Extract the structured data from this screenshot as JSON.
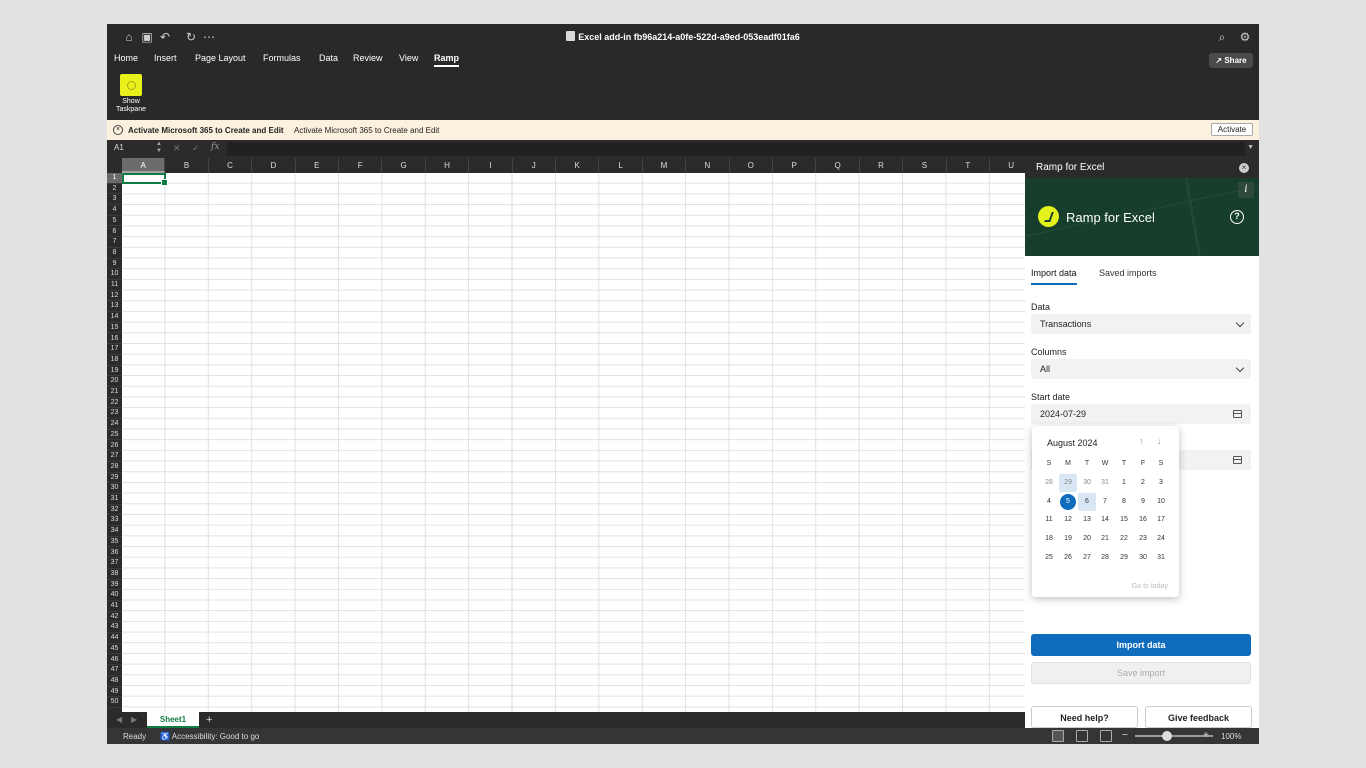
{
  "titlebar": {
    "title": "Excel add-in fb96a214-a0fe-522d-a9ed-053eadf01fa6"
  },
  "ribbon_tabs": [
    "Home",
    "Insert",
    "Page Layout",
    "Formulas",
    "Data",
    "Review",
    "View",
    "Ramp"
  ],
  "active_tab": "Ramp",
  "share_label": "Share",
  "ribbon": {
    "taskpane_line1": "Show",
    "taskpane_line2": "Taskpane"
  },
  "message_bar": {
    "bold": "Activate Microsoft 365 to Create and Edit",
    "text": "Activate Microsoft 365 to Create and Edit",
    "button": "Activate"
  },
  "formula_bar": {
    "name_box": "A1",
    "fx": "fx"
  },
  "grid": {
    "columns": [
      "A",
      "B",
      "C",
      "D",
      "E",
      "F",
      "G",
      "H",
      "I",
      "J",
      "K",
      "L",
      "M",
      "N",
      "O",
      "P",
      "Q",
      "R",
      "S",
      "T",
      "U"
    ],
    "rows": [
      "1",
      "2",
      "3",
      "4",
      "5",
      "6",
      "7",
      "8",
      "9",
      "10",
      "11",
      "12",
      "13",
      "14",
      "15",
      "16",
      "17",
      "18",
      "19",
      "20",
      "21",
      "22",
      "23",
      "24",
      "25",
      "26",
      "27",
      "28",
      "29",
      "30",
      "31",
      "32",
      "33",
      "34",
      "35",
      "36",
      "37",
      "38",
      "39",
      "40",
      "41",
      "42",
      "43",
      "44",
      "45",
      "46",
      "47",
      "48",
      "49",
      "50"
    ],
    "selected_cell": "A1"
  },
  "sheets": {
    "active": "Sheet1",
    "add": "+"
  },
  "status": {
    "ready": "Ready",
    "accessibility": "Accessibility: Good to go",
    "zoom": "100%",
    "zoom_fraction": 0.5
  },
  "taskpane": {
    "header": "Ramp for Excel",
    "hero_title": "Ramp for Excel",
    "tabs": [
      "Import data",
      "Saved imports"
    ],
    "data_label": "Data",
    "data_value": "Transactions",
    "columns_label": "Columns",
    "columns_value": "All",
    "start_label": "Start date",
    "start_value": "2024-07-29",
    "import_button": "Import data",
    "save_button": "Save import",
    "help_button": "Need help?",
    "feedback_button": "Give feedback"
  },
  "calendar": {
    "month": "August 2024",
    "weekdays": [
      "S",
      "M",
      "T",
      "W",
      "T",
      "F",
      "S"
    ],
    "weeks": [
      [
        "28",
        "29",
        "30",
        "31",
        "1",
        "2",
        "3"
      ],
      [
        "4",
        "5",
        "6",
        "7",
        "8",
        "9",
        "10"
      ],
      [
        "11",
        "12",
        "13",
        "14",
        "15",
        "16",
        "17"
      ],
      [
        "18",
        "19",
        "20",
        "21",
        "22",
        "23",
        "24"
      ],
      [
        "25",
        "26",
        "27",
        "28",
        "29",
        "30",
        "31"
      ]
    ],
    "go_to_today": "Go to today"
  },
  "colors": {
    "accent": "#0f6cbd",
    "excel_green": "#107c41",
    "ramp_yellow": "#e4f21b",
    "hero_bg": "#173e2c"
  }
}
